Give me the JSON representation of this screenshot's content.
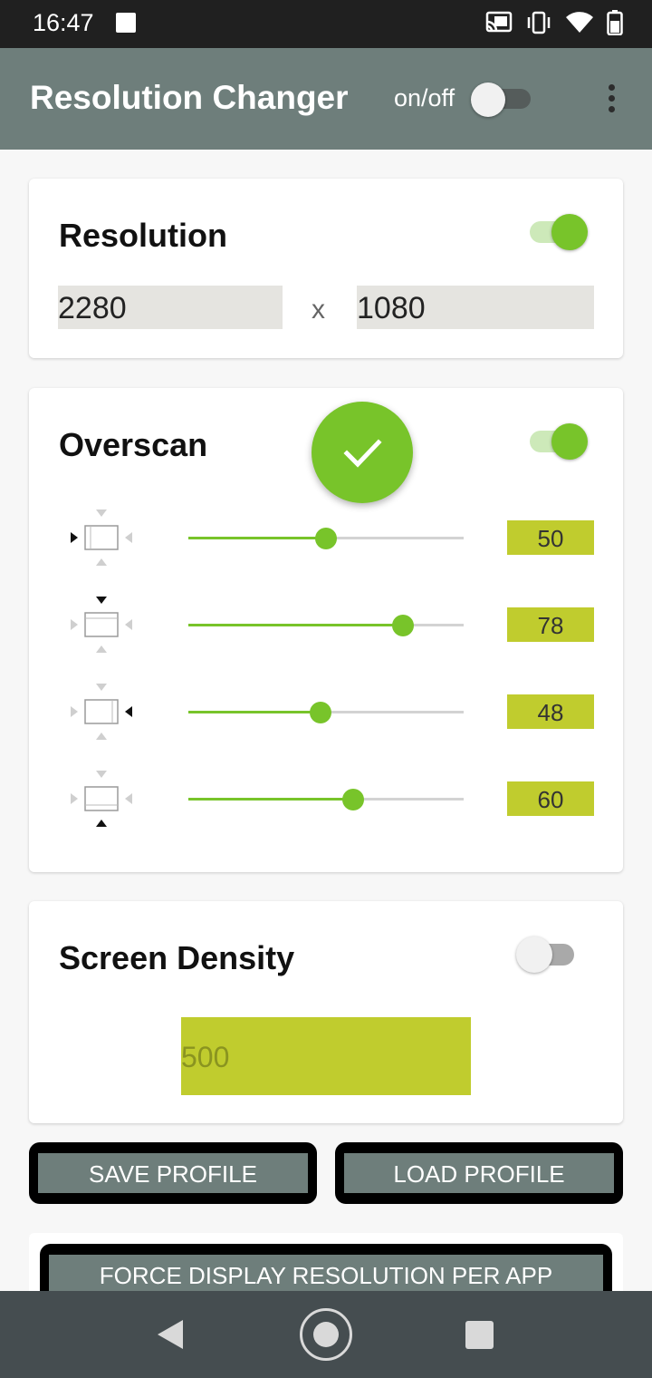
{
  "status_bar": {
    "time": "16:47",
    "icons": [
      "notification-square-icon",
      "cast-icon",
      "vibrate-icon",
      "wifi-icon",
      "battery-icon"
    ]
  },
  "app_bar": {
    "title": "Resolution Changer",
    "onoff_label": "on/off",
    "onoff_state": false,
    "menu_icon": "overflow-menu-icon",
    "background": "#6e7e7b"
  },
  "resolution": {
    "title": "Resolution",
    "enabled": true,
    "width": "2280",
    "separator": "x",
    "height": "1080"
  },
  "overscan": {
    "title": "Overscan",
    "enabled": true,
    "apply_icon": "checkmark-icon",
    "rows": [
      {
        "side": "left",
        "icon": "overscan-left-icon",
        "value": "50",
        "fraction": 0.5
      },
      {
        "side": "top",
        "icon": "overscan-top-icon",
        "value": "78",
        "fraction": 0.78
      },
      {
        "side": "right",
        "icon": "overscan-right-icon",
        "value": "48",
        "fraction": 0.48
      },
      {
        "side": "bottom",
        "icon": "overscan-bottom-icon",
        "value": "60",
        "fraction": 0.6
      }
    ]
  },
  "density": {
    "title": "Screen Density",
    "enabled": false,
    "placeholder": "500"
  },
  "buttons": {
    "save_profile": "SAVE PROFILE",
    "load_profile": "LOAD PROFILE",
    "force_display": "FORCE DISPLAY RESOLUTION PER APP"
  },
  "nav_bar": {
    "icons": [
      "back-icon",
      "home-icon",
      "recents-icon"
    ]
  },
  "colors": {
    "accent": "#78c42a",
    "value_box": "#c0cc2e",
    "button_fill": "#6e7e7b"
  }
}
